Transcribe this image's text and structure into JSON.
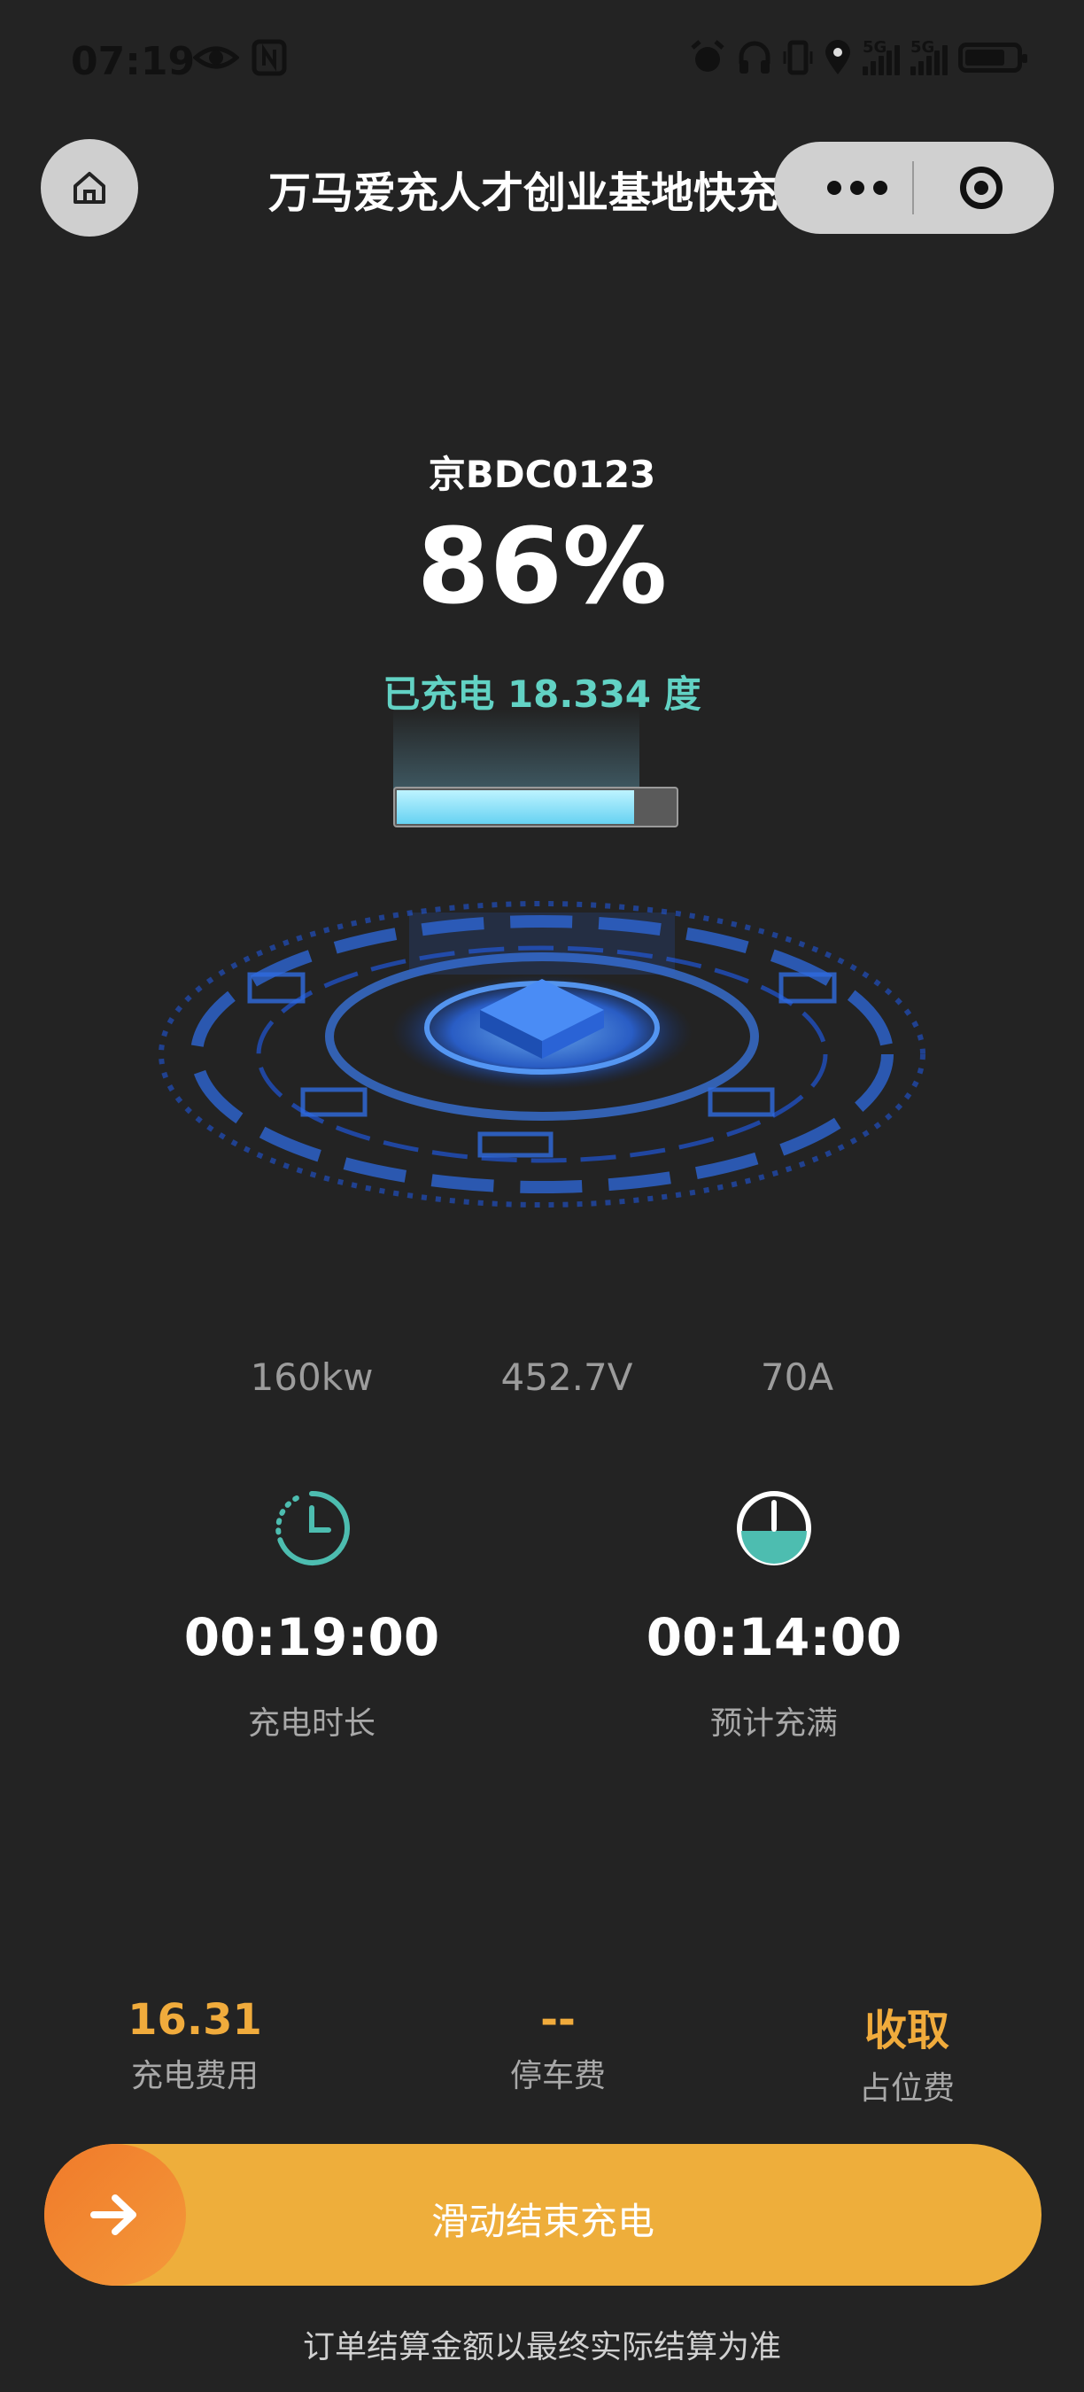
{
  "status_bar": {
    "time": "07:19",
    "left_icons": [
      "eye-icon",
      "nfc-icon"
    ],
    "right_icons": [
      "alarm-icon",
      "headphones-icon",
      "vibrate-icon",
      "location-icon"
    ],
    "network_1": "5G",
    "network_2": "5G",
    "battery_level": 0.85
  },
  "header": {
    "title": "万马爱充人才创业基地快充站"
  },
  "charging": {
    "plate": "京BDC0123",
    "percent": "86%",
    "percent_value": 86,
    "charged_text": "已充电 18.334 度"
  },
  "metrics": [
    {
      "value": "160kw"
    },
    {
      "value": "452.7V"
    },
    {
      "value": "70A"
    }
  ],
  "timers": [
    {
      "value": "00:19:00",
      "label": "充电时长",
      "icon": "clock-icon"
    },
    {
      "value": "00:14:00",
      "label": "预计充满",
      "icon": "half-full-icon"
    }
  ],
  "fees": [
    {
      "value": "16.31",
      "label": "充电费用"
    },
    {
      "value": "--",
      "label": "停车费"
    },
    {
      "value": "收取",
      "label": "占位费"
    }
  ],
  "slider": {
    "label": "滑动结束充电"
  },
  "footer_note": "订单结算金额以最终实际结算为准",
  "colors": {
    "background": "#232323",
    "accent_teal": "#62d2c4",
    "fee_orange": "#f0ab3c",
    "slider_bg": "#eeae3b",
    "knob": "#f07a2a"
  }
}
